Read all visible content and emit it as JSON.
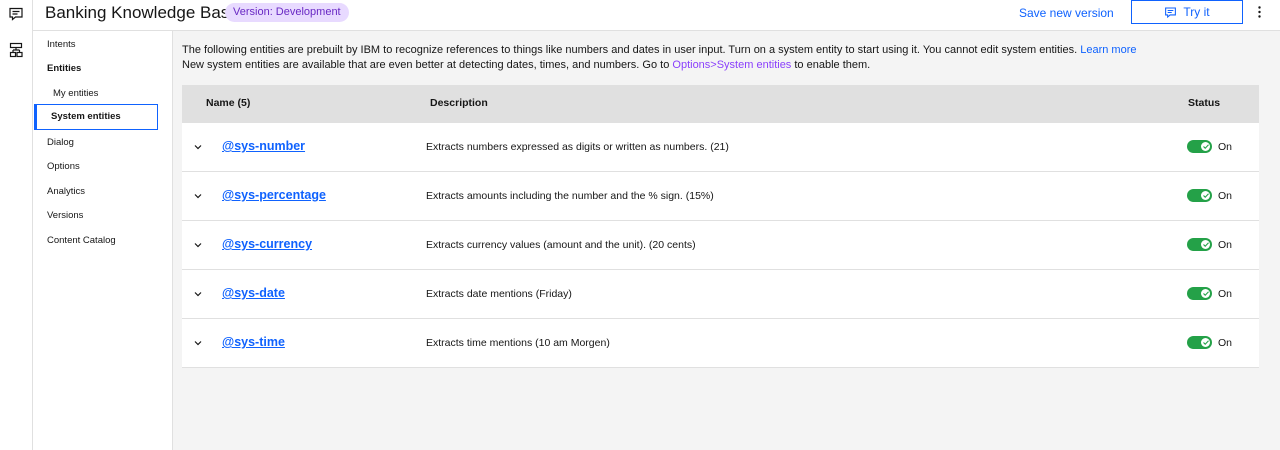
{
  "header": {
    "title": "Banking Knowledge Base",
    "version_tag": "Version: Development",
    "save_version": "Save new version",
    "try_it": "Try it"
  },
  "rail": {
    "icons": [
      "chat-icon",
      "flow-icon"
    ]
  },
  "sidenav": {
    "intents": "Intents",
    "entities": "Entities",
    "my_entities": "My entities",
    "system_entities": "System entities",
    "dialog": "Dialog",
    "options": "Options",
    "analytics": "Analytics",
    "versions": "Versions",
    "content_catalog": "Content Catalog"
  },
  "intro": {
    "line1": "The following entities are prebuilt by IBM to recognize references to things like numbers and dates in user input. Turn on a system entity to start using it. You cannot edit system entities.",
    "learn_more": "Learn more",
    "line2_pre": "New system entities are available that are even better at detecting dates, times, and numbers. Go to",
    "options_link": "Options>System entities",
    "line2_post": "to enable them."
  },
  "table": {
    "col_name": "Name (5)",
    "col_description": "Description",
    "col_status": "Status",
    "rows": [
      {
        "name": "@sys-number",
        "description": "Extracts numbers expressed as digits or written as numbers. (21)",
        "status": "On",
        "enabled": true
      },
      {
        "name": "@sys-percentage",
        "description": "Extracts amounts including the number and the % sign. (15%)",
        "status": "On",
        "enabled": true
      },
      {
        "name": "@sys-currency",
        "description": "Extracts currency values (amount and the unit). (20 cents)",
        "status": "On",
        "enabled": true
      },
      {
        "name": "@sys-date",
        "description": "Extracts date mentions (Friday)",
        "status": "On",
        "enabled": true
      },
      {
        "name": "@sys-time",
        "description": "Extracts time mentions (10 am Morgen)",
        "status": "On",
        "enabled": true
      }
    ]
  },
  "colors": {
    "accent": "#0f62fe",
    "tag_bg": "#e8daff",
    "tag_text": "#6929c4",
    "toggle_on": "#24a148"
  }
}
